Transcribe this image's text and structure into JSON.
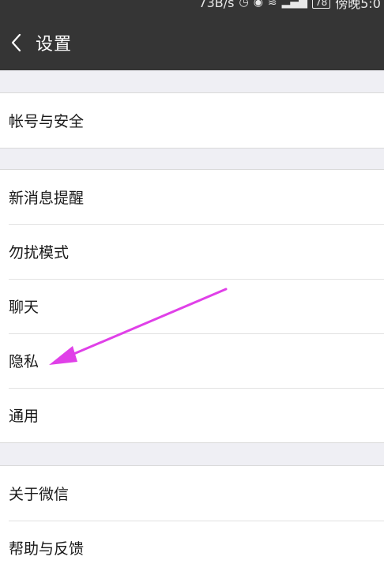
{
  "status_bar": {
    "speed": "73B/s",
    "battery": "78",
    "time": "傍晚5:0"
  },
  "header": {
    "title": "设置"
  },
  "groups": [
    {
      "items": [
        {
          "label": "帐号与安全"
        }
      ]
    },
    {
      "items": [
        {
          "label": "新消息提醒"
        },
        {
          "label": "勿扰模式"
        },
        {
          "label": "聊天"
        },
        {
          "label": "隐私"
        },
        {
          "label": "通用"
        }
      ]
    },
    {
      "items": [
        {
          "label": "关于微信"
        },
        {
          "label": "帮助与反馈"
        }
      ]
    }
  ],
  "colors": {
    "header_bg": "#353535",
    "page_bg": "#efeff4",
    "arrow": "#e040e8"
  },
  "icons": [
    "back-chevron-icon",
    "clock-icon",
    "eye-icon",
    "wifi-icon",
    "signal-icon",
    "battery-icon"
  ]
}
